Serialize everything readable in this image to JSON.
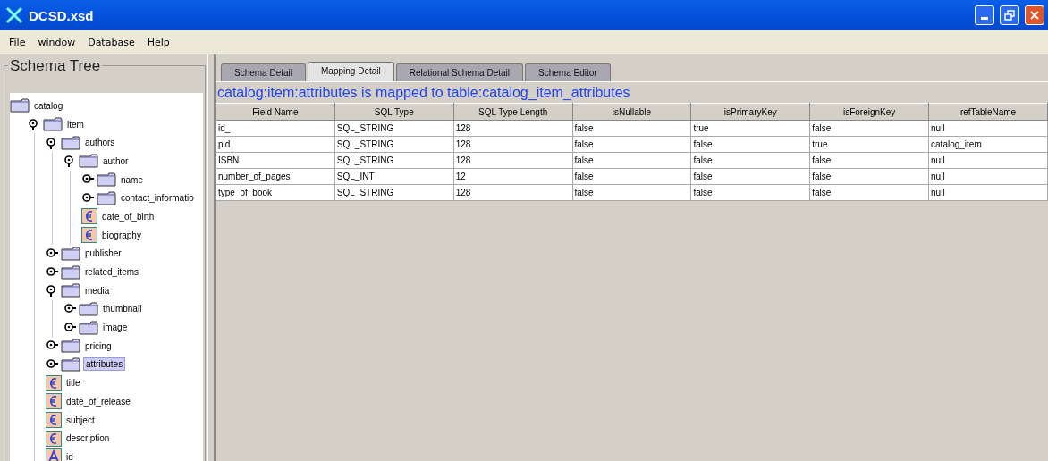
{
  "window": {
    "title": "DCSD.xsd"
  },
  "menu": [
    "File",
    "window",
    "Database",
    "Help"
  ],
  "schema_tree": {
    "title": "Schema Tree",
    "nodes": [
      {
        "label": "catalog",
        "kind": "folder",
        "selected": false,
        "children": [
          {
            "label": "item",
            "kind": "folder",
            "expanded": true,
            "selected": false,
            "children": [
              {
                "label": "authors",
                "kind": "folder",
                "expanded": true,
                "selected": false,
                "children": [
                  {
                    "label": "author",
                    "kind": "folder",
                    "expanded": true,
                    "selected": false,
                    "children": [
                      {
                        "label": "name",
                        "kind": "folder",
                        "expanded": false,
                        "selected": false
                      },
                      {
                        "label": "contact_informatio",
                        "kind": "folder",
                        "expanded": false,
                        "selected": false
                      },
                      {
                        "label": "date_of_birth",
                        "kind": "element",
                        "selected": false
                      },
                      {
                        "label": "biography",
                        "kind": "element",
                        "selected": false
                      }
                    ]
                  }
                ]
              },
              {
                "label": "publisher",
                "kind": "folder",
                "expanded": false,
                "selected": false
              },
              {
                "label": "related_items",
                "kind": "folder",
                "expanded": false,
                "selected": false
              },
              {
                "label": "media",
                "kind": "folder",
                "expanded": true,
                "selected": false,
                "children": [
                  {
                    "label": "thumbnail",
                    "kind": "folder",
                    "expanded": false,
                    "selected": false
                  },
                  {
                    "label": "image",
                    "kind": "folder",
                    "expanded": false,
                    "selected": false
                  }
                ]
              },
              {
                "label": "pricing",
                "kind": "folder",
                "expanded": false,
                "selected": false
              },
              {
                "label": "attributes",
                "kind": "folder",
                "expanded": false,
                "selected": true
              },
              {
                "label": "title",
                "kind": "element",
                "selected": false
              },
              {
                "label": "date_of_release",
                "kind": "element",
                "selected": false
              },
              {
                "label": "subject",
                "kind": "element",
                "selected": false
              },
              {
                "label": "description",
                "kind": "element",
                "selected": false
              },
              {
                "label": "id",
                "kind": "attribute",
                "selected": false
              }
            ]
          }
        ]
      }
    ]
  },
  "tabs": [
    {
      "label": "Schema Detail",
      "selected": false
    },
    {
      "label": "Mapping Detail",
      "selected": true
    },
    {
      "label": "Relational Schema Detail",
      "selected": false
    },
    {
      "label": "Schema Editor",
      "selected": false
    }
  ],
  "mapping_title": "catalog:item:attributes is mapped to table:catalog_item_attributes",
  "table": {
    "columns": [
      "Field Name",
      "SQL Type",
      "SQL Type Length",
      "isNullable",
      "isPrimaryKey",
      "isForeignKey",
      "refTableName"
    ],
    "rows": [
      [
        "id_",
        "SQL_STRING",
        "128",
        "false",
        "true",
        "false",
        "null"
      ],
      [
        "pid",
        "SQL_STRING",
        "128",
        "false",
        "false",
        "true",
        "catalog_item"
      ],
      [
        "ISBN",
        "SQL_STRING",
        "128",
        "false",
        "false",
        "false",
        "null"
      ],
      [
        "number_of_pages",
        "SQL_INT",
        "12",
        "false",
        "false",
        "false",
        "null"
      ],
      [
        "type_of_book",
        "SQL_STRING",
        "128",
        "false",
        "false",
        "false",
        "null"
      ]
    ]
  }
}
